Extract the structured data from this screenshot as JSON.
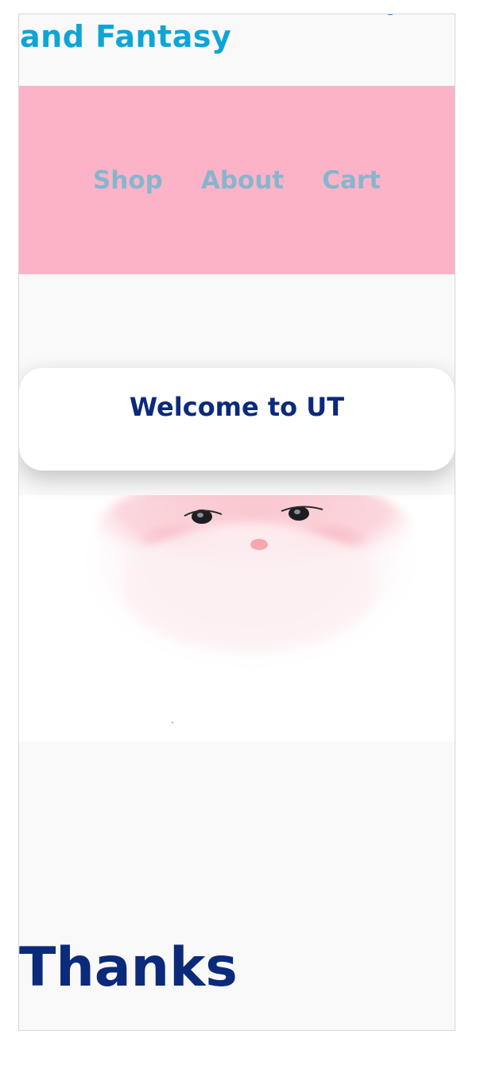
{
  "header": {
    "site_title": "and Fantasy"
  },
  "nav": {
    "items": [
      {
        "label": "Shop"
      },
      {
        "label": "About"
      },
      {
        "label": "Cart"
      }
    ]
  },
  "welcome": {
    "heading": "Welcome to UT"
  },
  "hero": {
    "image": "santa-face-illustration"
  },
  "footer": {
    "thanks": "Thanks"
  },
  "colors": {
    "title": "#0ea5d6",
    "nav_background": "#fcb3c7",
    "nav_link": "#86b6ce",
    "heading": "#0c2a7a",
    "page_background": "#f9f9f9"
  }
}
